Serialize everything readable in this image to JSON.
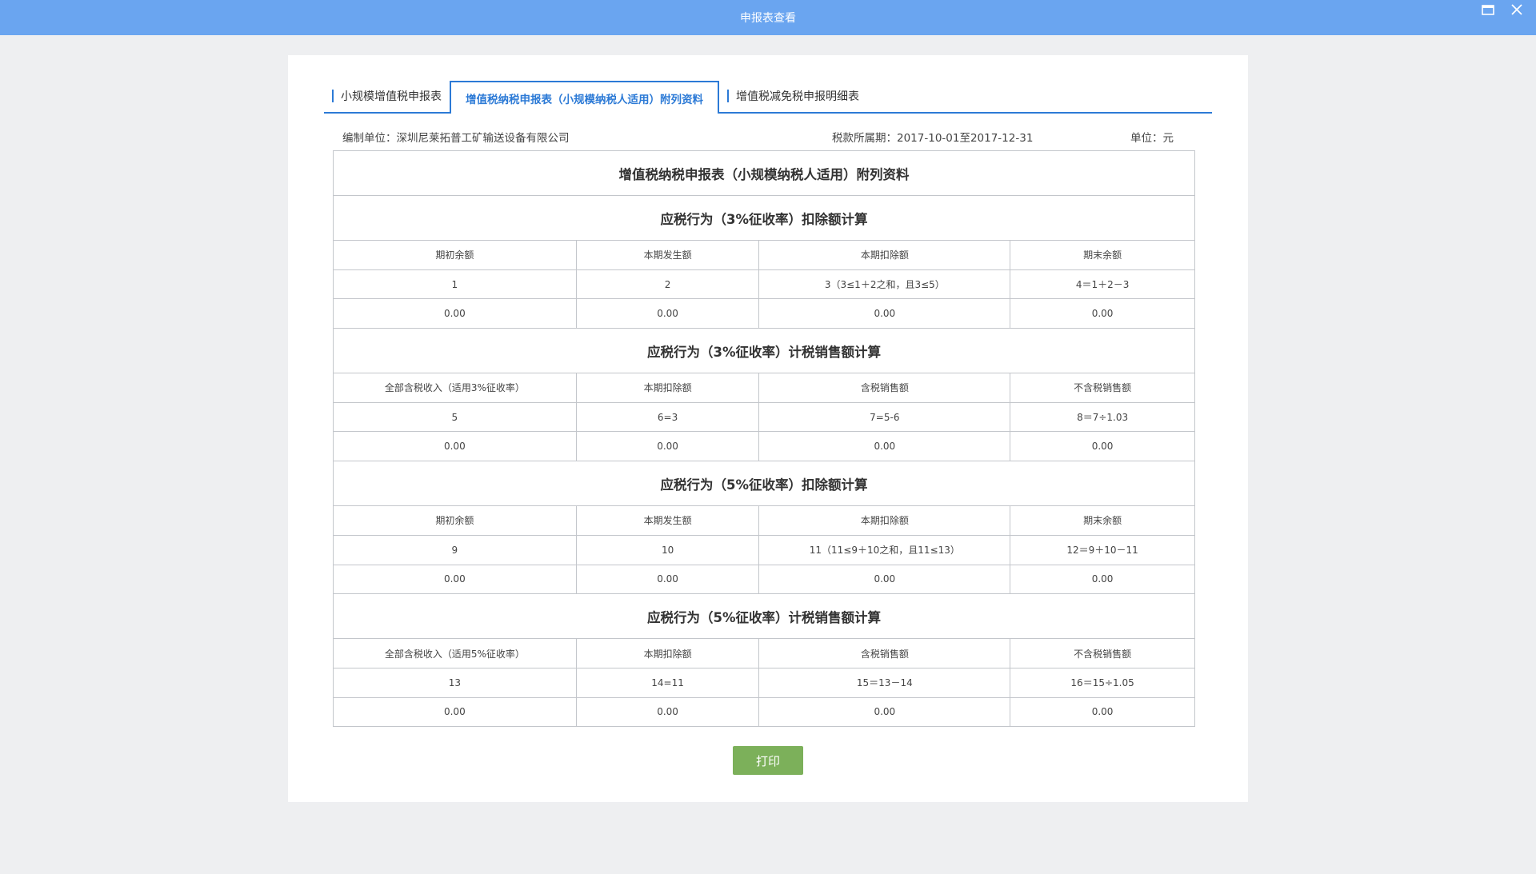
{
  "window": {
    "title": "申报表查看",
    "colors": {
      "titlebar": "#6aa5f0",
      "accent": "#2c7ad6",
      "print_button": "#7cb05a"
    },
    "controls": [
      "restore-icon",
      "close-icon"
    ]
  },
  "tabs": [
    {
      "label": "小规模增值税申报表",
      "active": false
    },
    {
      "label": "增值税纳税申报表（小规模纳税人适用）附列资料",
      "active": true
    },
    {
      "label": "增值税减免税申报明细表",
      "active": false
    }
  ],
  "info": {
    "company": "编制单位：深圳尼莱拓普工矿输送设备有限公司",
    "period": "税款所属期：2017-10-01至2017-12-31",
    "unit": "单位：元"
  },
  "table": {
    "title": "增值税纳税申报表（小规模纳税人适用）附列资料",
    "sections": [
      {
        "heading": "应税行为（3%征收率）扣除额计算",
        "headers": [
          "期初余额",
          "本期发生额",
          "本期扣除额",
          "期末余额"
        ],
        "formulas": [
          "1",
          "2",
          "3（3≤1＋2之和，且3≤5）",
          "4＝1＋2－3"
        ],
        "values": [
          "0.00",
          "0.00",
          "0.00",
          "0.00"
        ]
      },
      {
        "heading": "应税行为（3%征收率）计税销售额计算",
        "headers": [
          "全部含税收入（适用3%征收率）",
          "本期扣除额",
          "含税销售额",
          "不含税销售额"
        ],
        "formulas": [
          "5",
          "6=3",
          "7=5-6",
          "8＝7÷1.03"
        ],
        "values": [
          "0.00",
          "0.00",
          "0.00",
          "0.00"
        ]
      },
      {
        "heading": "应税行为（5%征收率）扣除额计算",
        "headers": [
          "期初余额",
          "本期发生额",
          "本期扣除额",
          "期末余额"
        ],
        "formulas": [
          "9",
          "10",
          "11（11≤9＋10之和，且11≤13）",
          "12＝9＋10－11"
        ],
        "values": [
          "0.00",
          "0.00",
          "0.00",
          "0.00"
        ]
      },
      {
        "heading": "应税行为（5%征收率）计税销售额计算",
        "headers": [
          "全部含税收入（适用5%征收率）",
          "本期扣除额",
          "含税销售额",
          "不含税销售额"
        ],
        "formulas": [
          "13",
          "14=11",
          "15＝13－14",
          "16＝15÷1.05"
        ],
        "values": [
          "0.00",
          "0.00",
          "0.00",
          "0.00"
        ]
      }
    ]
  },
  "print_label": "打印"
}
